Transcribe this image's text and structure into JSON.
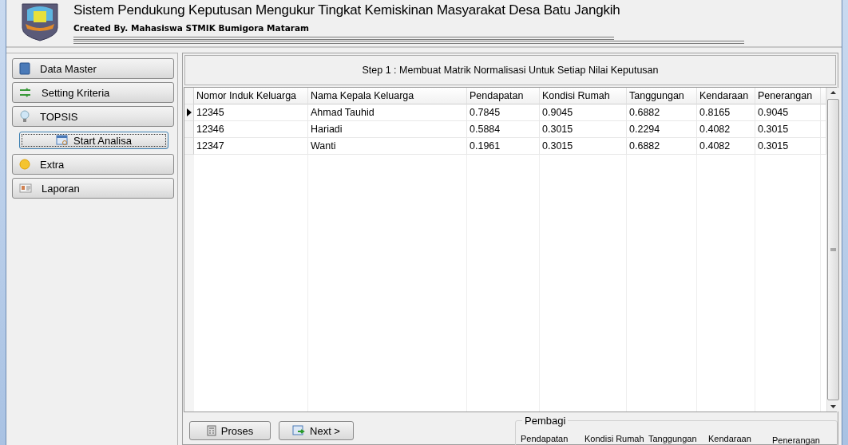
{
  "header": {
    "title": "Sistem Pendukung Keputusan Mengukur Tingkat Kemiskinan Masyarakat Desa Batu Jangkih",
    "subtitle": "Created By. Mahasiswa STMIK Bumigora Mataram"
  },
  "sidebar": {
    "items": [
      {
        "label": "Data Master",
        "kind": "group",
        "selected": false
      },
      {
        "label": "Setting Kriteria",
        "kind": "group",
        "selected": false
      },
      {
        "label": "TOPSIS",
        "kind": "group",
        "selected": false
      },
      {
        "label": "Start Analisa",
        "kind": "sub",
        "selected": true
      },
      {
        "label": "Extra",
        "kind": "group",
        "selected": false
      },
      {
        "label": "Laporan",
        "kind": "group",
        "selected": false
      }
    ]
  },
  "step_title": "Step 1 : Membuat Matrik Normalisasi Untuk Setiap Nilai Keputusan",
  "table": {
    "columns": [
      "Nomor Induk Keluarga",
      "Nama Kepala Keluarga",
      "Pendapatan",
      "Kondisi Rumah",
      "Tanggungan",
      "Kendaraan",
      "Penerangan"
    ],
    "rows": [
      {
        "selected": true,
        "cells": [
          "12345",
          "Ahmad Tauhid",
          "0.7845",
          "0.9045",
          "0.6882",
          "0.8165",
          "0.9045"
        ]
      },
      {
        "selected": false,
        "cells": [
          "12346",
          "Hariadi",
          "0.5884",
          "0.3015",
          "0.2294",
          "0.4082",
          "0.3015"
        ]
      },
      {
        "selected": false,
        "cells": [
          "12347",
          "Wanti",
          "0.1961",
          "0.3015",
          "0.6882",
          "0.4082",
          "0.3015"
        ]
      }
    ]
  },
  "buttons": [
    "Proses",
    "Next >"
  ],
  "pembagi": {
    "title": "Pembagi",
    "labels": [
      "Pendapatan",
      "Kondisi Rumah",
      "Tanggungan",
      "Kendaraan",
      "Penerangan"
    ]
  }
}
